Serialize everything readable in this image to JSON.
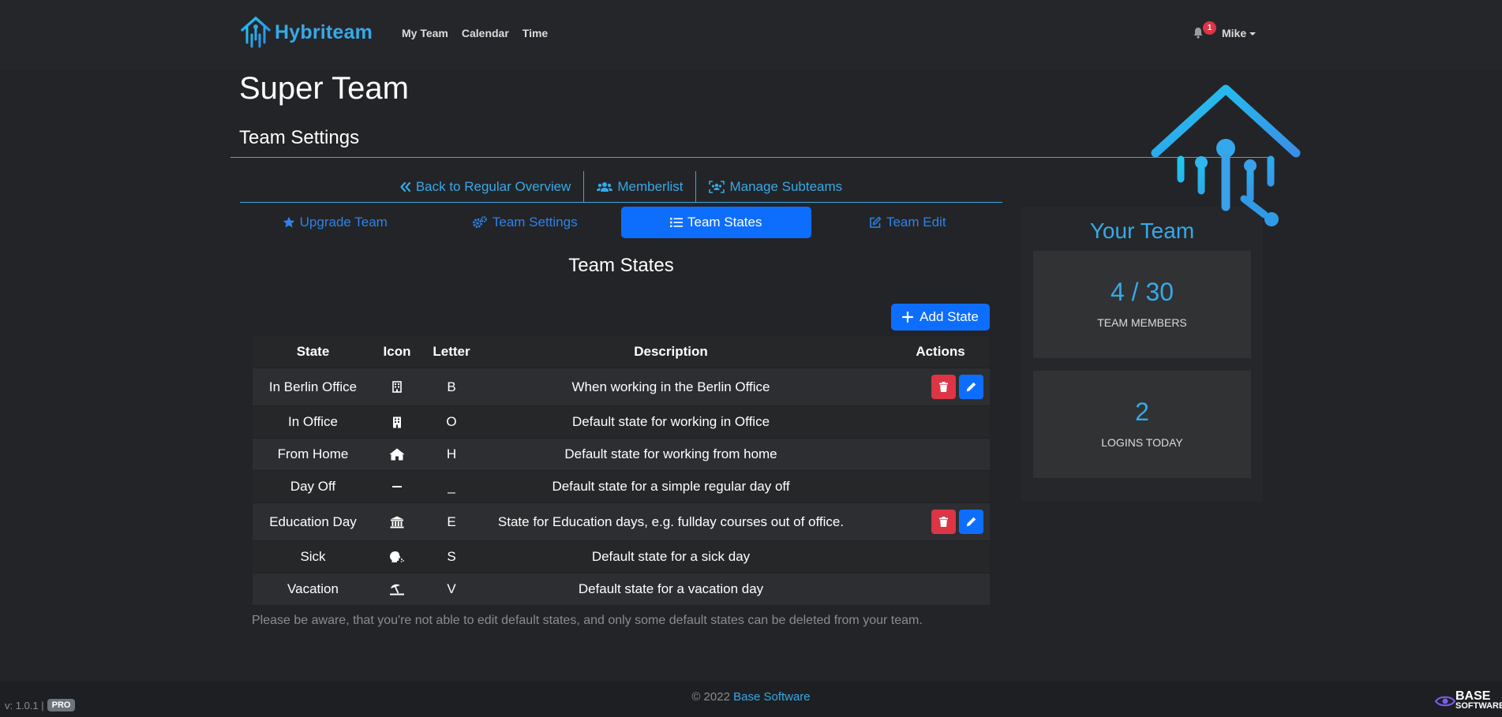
{
  "navbar": {
    "brand": "Hybriteam",
    "links": [
      "My Team",
      "Calendar",
      "Time"
    ],
    "notification_count": "1",
    "user": "Mike"
  },
  "page": {
    "title": "Super Team",
    "subtitle": "Team Settings"
  },
  "subnav": {
    "back": "Back to Regular Overview",
    "memberlist": "Memberlist",
    "subteams": "Manage Subteams"
  },
  "tabs": [
    "Upgrade Team",
    "Team Settings",
    "Team States",
    "Team Edit"
  ],
  "section_title": "Team States",
  "add_button": "Add State",
  "table": {
    "headers": [
      "State",
      "Icon",
      "Letter",
      "Description",
      "Actions"
    ],
    "rows": [
      {
        "state": "In Berlin Office",
        "icon": "building-outline-icon",
        "letter": "B",
        "description": "When working in the Berlin Office",
        "actions": true
      },
      {
        "state": "In Office",
        "icon": "building-icon",
        "letter": "O",
        "description": "Default state for working in Office",
        "actions": false
      },
      {
        "state": "From Home",
        "icon": "house-icon",
        "letter": "H",
        "description": "Default state for working from home",
        "actions": false
      },
      {
        "state": "Day Off",
        "icon": "minus-icon",
        "letter": "_",
        "description": "Default state for a simple regular day off",
        "actions": false
      },
      {
        "state": "Education Day",
        "icon": "university-icon",
        "letter": "E",
        "description": "State for Education days, e.g. fullday courses out of office.",
        "actions": true
      },
      {
        "state": "Sick",
        "icon": "head-virus-icon",
        "letter": "S",
        "description": "Default state for a sick day",
        "actions": false
      },
      {
        "state": "Vacation",
        "icon": "umbrella-beach-icon",
        "letter": "V",
        "description": "Default state for a vacation day",
        "actions": false
      }
    ]
  },
  "note": "Please be aware, that you're not able to edit default states, and only some default states can be deleted from your team.",
  "side": {
    "title": "Your Team",
    "members_value": "4 / 30",
    "members_label": "TEAM MEMBERS",
    "logins_value": "2",
    "logins_label": "LOGINS TODAY"
  },
  "footer": {
    "copyright_prefix": "© 2022",
    "company": "Base Software",
    "version": "v: 1.0.1 |",
    "pro": "PRO",
    "logo_line1": "BASE",
    "logo_line2": "SOFTWARE"
  },
  "colors": {
    "accent": "#36a9e8",
    "primary": "#0d6efd",
    "danger": "#dc3545",
    "background": "#232427"
  }
}
